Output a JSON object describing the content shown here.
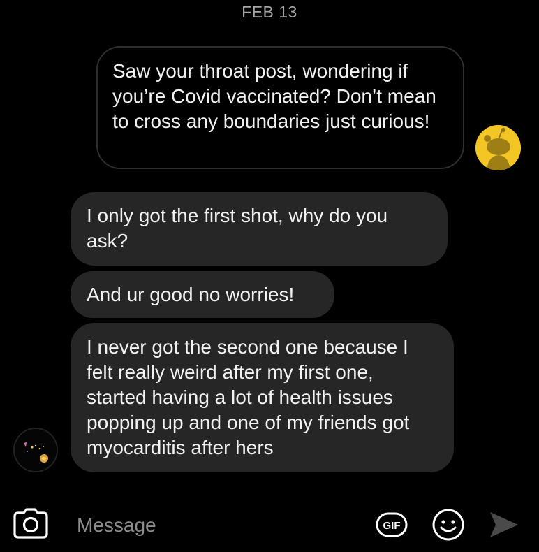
{
  "date_header": "FEB 13",
  "messages": [
    {
      "direction": "sent",
      "text": "Saw your throat post, wondering if you’re Covid vaccinated? Don’t mean to cross any boundaries just curious!"
    },
    {
      "direction": "received",
      "text": "I only got the first shot, why do you ask?"
    },
    {
      "direction": "received",
      "text": "And ur good no worries!"
    },
    {
      "direction": "received",
      "text": "I never got the second one because I felt really weird after my first one, started having a lot of health issues popping up and one of my friends got myocarditis after hers"
    }
  ],
  "avatars": {
    "sent": {
      "icon": "snoo-avatar-icon",
      "color": "#f3c626"
    },
    "received": {
      "icon": "user-avatar-icon",
      "color": "#050505"
    }
  },
  "composer": {
    "placeholder": "Message",
    "camera_icon": "camera-icon",
    "gif_label": "GIF",
    "emoji_icon": "emoji-icon",
    "send_icon": "send-icon"
  },
  "colors": {
    "background": "#000000",
    "received_bubble": "#262626",
    "sent_bubble_border": "#2f2f2f",
    "text": "#f2f2f2",
    "muted": "#a5a5a5"
  }
}
